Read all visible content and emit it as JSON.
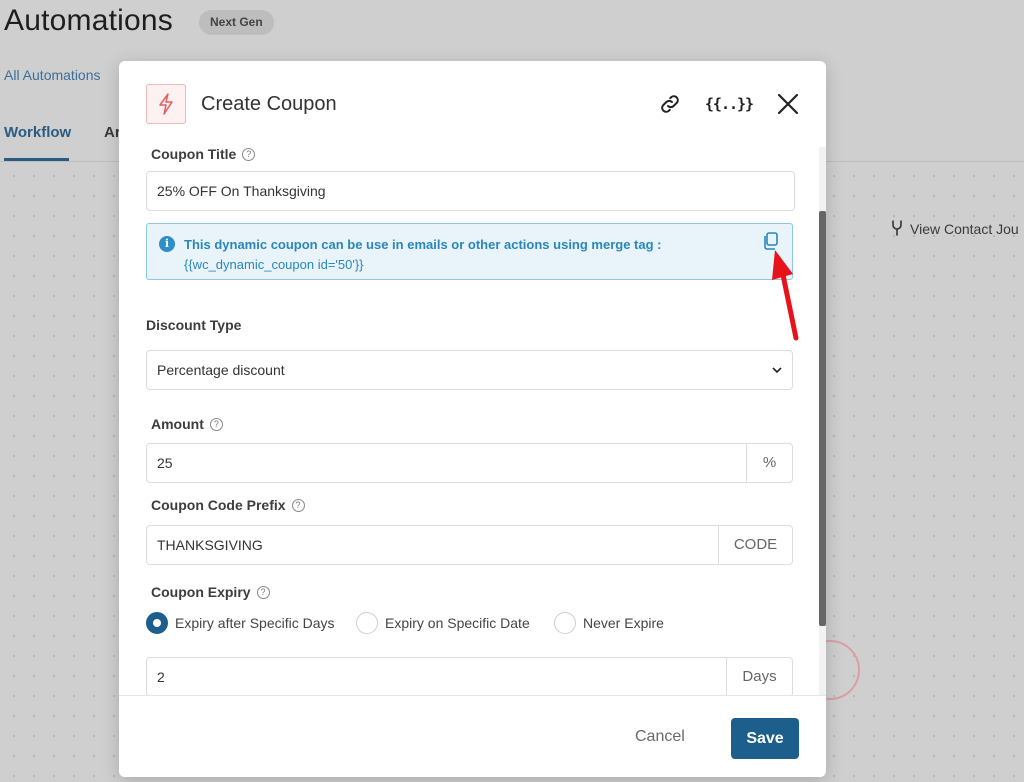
{
  "page": {
    "title": "Automations",
    "badge": "Next Gen",
    "breadcrumb": "All Automations",
    "tabs": [
      "Workflow",
      "Ar"
    ],
    "view_contact": "View Contact Jou"
  },
  "modal": {
    "icon": "bolt-icon",
    "title": "Create Coupon",
    "header_icons": [
      "link-icon",
      "merge-tag-icon",
      "close-icon"
    ],
    "merge_tag_glyph": "{{..}}",
    "coupon_title": {
      "label": "Coupon Title",
      "value": "25% OFF On Thanksgiving"
    },
    "info": {
      "line1": "This dynamic coupon can be use in emails or other actions using merge tag :",
      "line2": "{{wc_dynamic_coupon id='50'}}",
      "icon": "copy-icon"
    },
    "discount_type": {
      "label": "Discount Type",
      "selected": "Percentage discount"
    },
    "amount": {
      "label": "Amount",
      "value": "25",
      "suffix": "%"
    },
    "prefix": {
      "label": "Coupon Code Prefix",
      "value": "THANKSGIVING",
      "suffix": "CODE"
    },
    "expiry": {
      "label": "Coupon Expiry",
      "options": [
        "Expiry after Specific Days",
        "Expiry on Specific Date",
        "Never Expire"
      ],
      "selected_index": 0,
      "days_value": "2",
      "days_suffix": "Days"
    },
    "footer": {
      "cancel": "Cancel",
      "save": "Save"
    }
  },
  "colors": {
    "primary": "#1c5f8d",
    "info_text": "#2a86bd",
    "info_bg": "#e8f4fa",
    "annotation_arrow": "#e8121b"
  }
}
